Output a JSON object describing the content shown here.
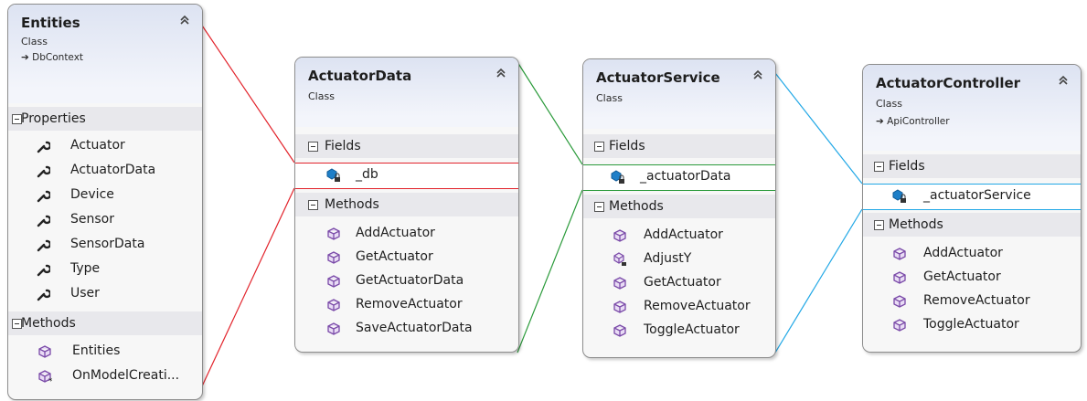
{
  "colors": {
    "link_entities_actuatordata": "#e2232b",
    "link_actuatordata_actuatorservice": "#2a9a3a",
    "link_actuatorservice_controller": "#22a8e6",
    "header_gradient_top": "#dde3f2",
    "section_background": "#e8e8ec",
    "method_icon": "#7a4aa8",
    "field_icon": "#1e7fc8"
  },
  "entities": {
    "title": "Entities",
    "kind": "Class",
    "base": "DbContext",
    "properties_label": "Properties",
    "properties": [
      "Actuator",
      "ActuatorData",
      "Device",
      "Sensor",
      "SensorData",
      "Type",
      "User"
    ],
    "methods_label": "Methods",
    "methods": [
      "Entities",
      "OnModelCreati..."
    ]
  },
  "actuator_data": {
    "title": "ActuatorData",
    "kind": "Class",
    "fields_label": "Fields",
    "fields": [
      "_db"
    ],
    "methods_label": "Methods",
    "methods": [
      "AddActuator",
      "GetActuator",
      "GetActuatorData",
      "RemoveActuator",
      "SaveActuatorData"
    ]
  },
  "actuator_service": {
    "title": "ActuatorService",
    "kind": "Class",
    "fields_label": "Fields",
    "fields": [
      "_actuatorData"
    ],
    "methods_label": "Methods",
    "methods": [
      "AddActuator",
      "AdjustY",
      "GetActuator",
      "RemoveActuator",
      "ToggleActuator"
    ]
  },
  "actuator_controller": {
    "title": "ActuatorController",
    "kind": "Class",
    "base": "ApiController",
    "fields_label": "Fields",
    "fields": [
      "_actuatorService"
    ],
    "methods_label": "Methods",
    "methods": [
      "AddActuator",
      "GetActuator",
      "RemoveActuator",
      "ToggleActuator"
    ]
  }
}
